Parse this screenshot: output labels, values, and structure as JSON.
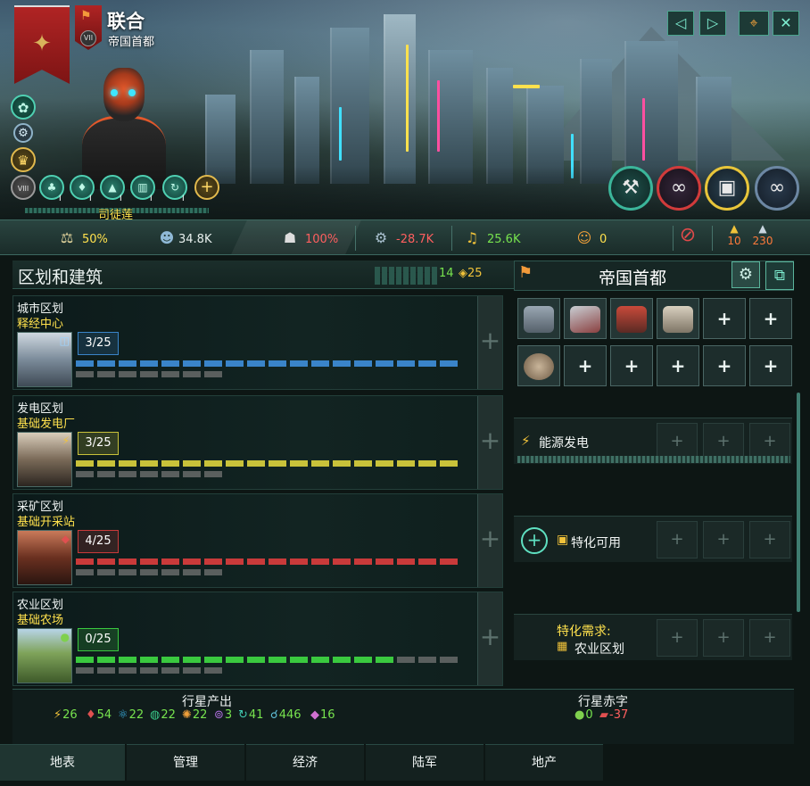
{
  "header": {
    "planet_name": "联合",
    "planet_subtitle": "帝国首都",
    "governor_name": "司徒莲",
    "species_rank": "VII",
    "trait_rank": "VIII",
    "trait_levels": [
      "I",
      "I",
      "I",
      "I",
      "I"
    ],
    "icons": {
      "banner": "empire-banner-eagle-icon",
      "side": [
        "ascension-wreath-icon",
        "gear-badge-icon",
        "leader-rank-icon"
      ],
      "traits": [
        "trait-rank-icon",
        "trait-1-icon",
        "trait-2-icon",
        "trait-3-icon",
        "trait-4-icon",
        "trait-5-icon",
        "add-trait-icon"
      ],
      "top_buttons": [
        "previous-icon",
        "next-icon",
        "focus-camera-icon",
        "close-icon"
      ],
      "actions": [
        "decision-icon",
        "resettle-icon",
        "build-queue-icon",
        "automation-icon"
      ]
    }
  },
  "stats": {
    "amenities": "50%",
    "population": "34.8K",
    "stability": "100%",
    "crime": "-28.7K",
    "trade": "25.6K",
    "free_jobs": "0",
    "housing_a": "10",
    "housing_b": "230"
  },
  "districts_panel": {
    "title": "区划和建筑",
    "used_slots": "14",
    "housing": "25",
    "districts": [
      {
        "name": "城市区划",
        "building": "释经中心",
        "count": "3/25",
        "color": "#3a84c9",
        "filled": 18
      },
      {
        "name": "发电区划",
        "building": "基础发电厂",
        "count": "3/25",
        "color": "#c9c23a",
        "filled": 18
      },
      {
        "name": "采矿区划",
        "building": "基础开采站",
        "count": "4/25",
        "color": "#c93a3a",
        "filled": 18
      },
      {
        "name": "农业区划",
        "building": "基础农场",
        "count": "0/25",
        "color": "#3ac93f",
        "filled": 15
      }
    ]
  },
  "capital_panel": {
    "title": "帝国首都",
    "specializations": [
      {
        "label": "能源发电"
      },
      {
        "label": "特化可用"
      }
    ],
    "requirement_title": "特化需求:",
    "requirement_value": "农业区划"
  },
  "output": {
    "planet_output_title": "行星产出",
    "planet_deficit_title": "行星赤字",
    "values": [
      {
        "icon": "energy-icon",
        "value": "26",
        "color": "#f0c23a"
      },
      {
        "icon": "minerals-icon",
        "value": "54",
        "color": "#e05050"
      },
      {
        "icon": "research-icon",
        "value": "22",
        "color": "#3ab0e0"
      },
      {
        "icon": "alloys-icon",
        "value": "22",
        "color": "#3ac98a"
      },
      {
        "icon": "consumer-goods-icon",
        "value": "22",
        "color": "#f0a03a"
      },
      {
        "icon": "unity-icon",
        "value": "3",
        "color": "#b070e0"
      },
      {
        "icon": "trade-icon",
        "value": "41",
        "color": "#40c9b0"
      },
      {
        "icon": "influence-icon",
        "value": "446",
        "color": "#60c0d8"
      },
      {
        "icon": "rare-crystal-icon",
        "value": "16",
        "color": "#d070d0"
      }
    ],
    "deficits": [
      {
        "icon": "food-icon",
        "value": "0",
        "color": "#7fd04e"
      },
      {
        "icon": "goods-icon",
        "value": "-37",
        "color": "#e05050"
      }
    ]
  },
  "tabs": [
    "地表",
    "管理",
    "经济",
    "陆军",
    "地产"
  ]
}
